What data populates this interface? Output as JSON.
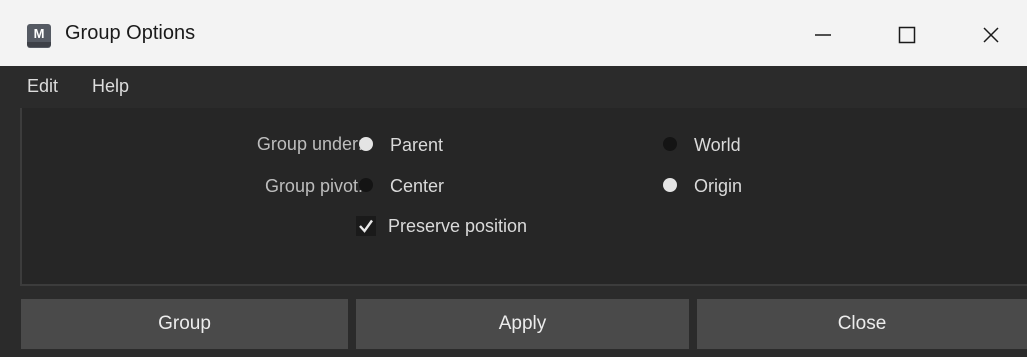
{
  "window": {
    "title": "Group Options",
    "app_icon_letter": "M",
    "controls": {
      "minimize": "minimize-icon",
      "maximize": "maximize-icon",
      "close": "close-icon"
    }
  },
  "menu": {
    "items": [
      "Edit",
      "Help"
    ]
  },
  "options": {
    "group_under": {
      "label": "Group under:",
      "choices": [
        "Parent",
        "World"
      ],
      "selected": "Parent"
    },
    "group_pivot": {
      "label": "Group pivot:",
      "choices": [
        "Center",
        "Origin"
      ],
      "selected": "Origin"
    },
    "preserve_position": {
      "label": "Preserve position",
      "checked": true
    }
  },
  "buttons": {
    "group": "Group",
    "apply": "Apply",
    "close": "Close"
  },
  "colors": {
    "background": "#2b2b2b",
    "panel": "#262626",
    "button": "#4a4a4a",
    "titlebar": "#f3f3f3"
  }
}
